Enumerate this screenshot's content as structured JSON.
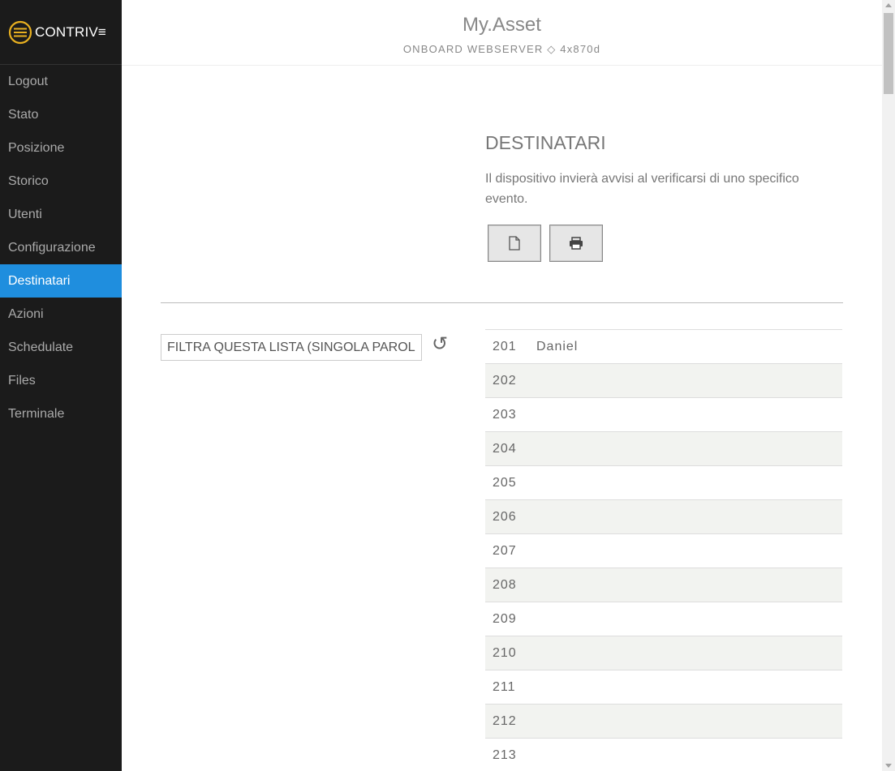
{
  "brand": {
    "logo_text": "CONTRIV≡"
  },
  "sidebar": {
    "items": [
      {
        "label": "Logout",
        "active": false
      },
      {
        "label": "Stato",
        "active": false
      },
      {
        "label": "Posizione",
        "active": false
      },
      {
        "label": "Storico",
        "active": false
      },
      {
        "label": "Utenti",
        "active": false
      },
      {
        "label": "Configurazione",
        "active": false
      },
      {
        "label": "Destinatari",
        "active": true
      },
      {
        "label": "Azioni",
        "active": false
      },
      {
        "label": "Schedulate",
        "active": false
      },
      {
        "label": "Files",
        "active": false
      },
      {
        "label": "Terminale",
        "active": false
      }
    ]
  },
  "header": {
    "title": "My.Asset",
    "subtitle": "ONBOARD WEBSERVER ◇ 4x870d"
  },
  "section": {
    "title": "DESTINATARI",
    "description": "Il dispositivo invierà avvisi al verificarsi di uno specifico evento."
  },
  "toolbar": {
    "new_icon": "file-icon",
    "print_icon": "printer-icon"
  },
  "filter": {
    "placeholder": "FILTRA QUESTA LISTA (SINGOLA PAROLA)",
    "value": "",
    "refresh_icon": "refresh-icon"
  },
  "recipients": [
    {
      "id": "201",
      "name": "Daniel"
    },
    {
      "id": "202",
      "name": ""
    },
    {
      "id": "203",
      "name": ""
    },
    {
      "id": "204",
      "name": ""
    },
    {
      "id": "205",
      "name": ""
    },
    {
      "id": "206",
      "name": ""
    },
    {
      "id": "207",
      "name": ""
    },
    {
      "id": "208",
      "name": ""
    },
    {
      "id": "209",
      "name": ""
    },
    {
      "id": "210",
      "name": ""
    },
    {
      "id": "211",
      "name": ""
    },
    {
      "id": "212",
      "name": ""
    },
    {
      "id": "213",
      "name": ""
    }
  ],
  "colors": {
    "sidebar_bg": "#1b1b1b",
    "accent": "#1f8ede",
    "row_alt": "#f2f3f0",
    "logo_ring": "#e8b020"
  }
}
